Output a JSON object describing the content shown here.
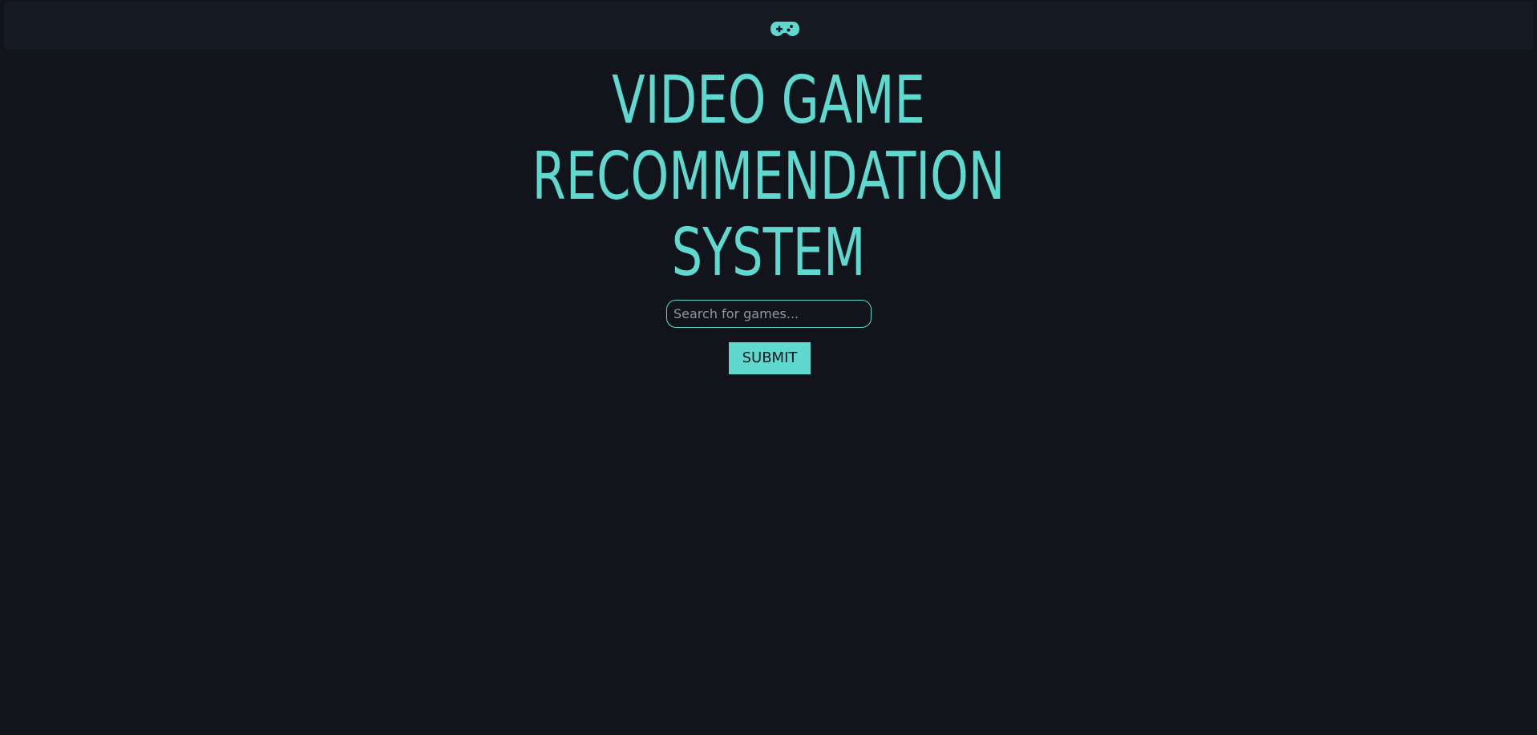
{
  "header": {
    "logo_icon": "gamepad-icon"
  },
  "hero": {
    "title_lines": [
      "VIDEO GAME",
      "RECOMMENDATION",
      "SYSTEM"
    ]
  },
  "search": {
    "placeholder": "Search for games...",
    "value": ""
  },
  "actions": {
    "submit_label": "SUBMIT"
  },
  "colors": {
    "background": "#11141b",
    "header": "#151921",
    "accent": "#5fd8cf",
    "button_text": "#0f1519"
  }
}
